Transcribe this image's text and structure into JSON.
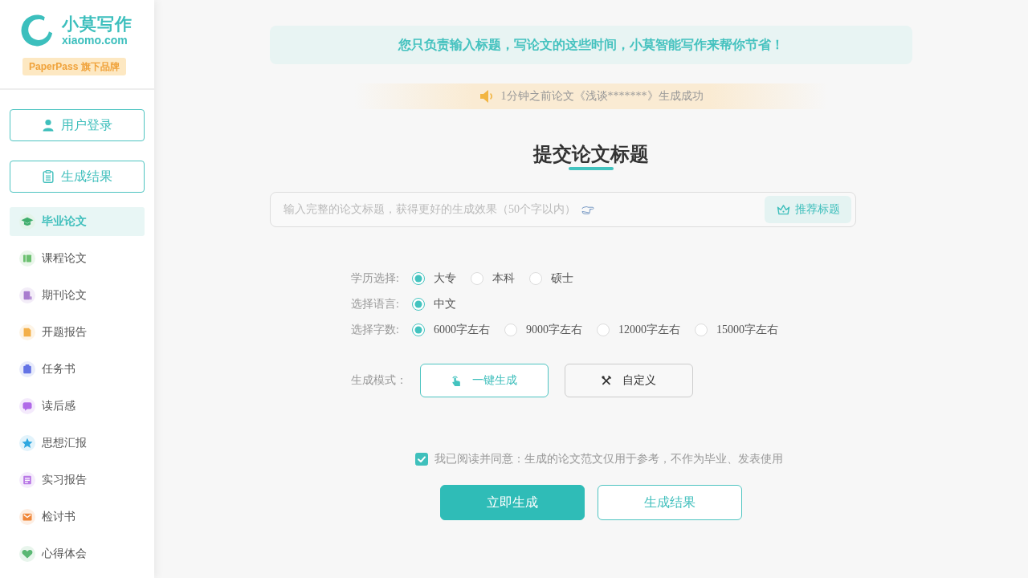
{
  "sidebar": {
    "logo": {
      "name": "小莫写作",
      "domain": "xiaomo.com",
      "badge": "PaperPass 旗下品牌"
    },
    "buttons": [
      {
        "label": "用户登录"
      },
      {
        "label": "生成结果"
      }
    ],
    "items": [
      {
        "label": "毕业论文",
        "selected": true,
        "color": "#3fae6c"
      },
      {
        "label": "课程论文",
        "selected": false,
        "color": "#6cc070"
      },
      {
        "label": "期刊论文",
        "selected": false,
        "color": "#a97ccf"
      },
      {
        "label": "开题报告",
        "selected": false,
        "color": "#f3b04a"
      },
      {
        "label": "任务书",
        "selected": false,
        "color": "#6474e5"
      },
      {
        "label": "读后感",
        "selected": false,
        "color": "#b06ae8"
      },
      {
        "label": "思想汇报",
        "selected": false,
        "color": "#2ea7e0"
      },
      {
        "label": "实习报告",
        "selected": false,
        "color": "#b979e6"
      },
      {
        "label": "检讨书",
        "selected": false,
        "color": "#f0873a"
      },
      {
        "label": "心得体会",
        "selected": false,
        "color": "#5bb874"
      }
    ]
  },
  "banner": "您只负责输入标题，写论文的这些时间，小莫智能写作来帮你节省！",
  "notice": "1分钟之前论文《浅谈*******》生成成功",
  "form": {
    "title": "提交论文标题",
    "title_input": {
      "placeholder": "输入完整的论文标题，获得更好的生成效果（50个字以内）",
      "button": "推荐标题"
    },
    "option_groups": [
      {
        "label": "学历选择:",
        "options": [
          {
            "label": "大专",
            "selected": true
          },
          {
            "label": "本科",
            "selected": false
          },
          {
            "label": "硕士",
            "selected": false
          }
        ]
      },
      {
        "label": "选择语言:",
        "options": [
          {
            "label": "中文",
            "selected": true
          }
        ]
      },
      {
        "label": "选择字数:",
        "options": [
          {
            "label": "6000字左右",
            "selected": true
          },
          {
            "label": "9000字左右",
            "selected": false
          },
          {
            "label": "12000字左右",
            "selected": false
          },
          {
            "label": "15000字左右",
            "selected": false
          }
        ]
      }
    ],
    "mode": {
      "label": "生成模式：",
      "options": [
        {
          "label": "一键生成",
          "selected": true
        },
        {
          "label": "自定义",
          "selected": false
        }
      ]
    },
    "agreement": {
      "checked": true,
      "text": "我已阅读并同意：生成的论文范文仅用于参考，不作为毕业、发表使用"
    },
    "actions": [
      {
        "label": "立即生成",
        "kind": "primary"
      },
      {
        "label": "生成结果",
        "kind": "outline"
      }
    ]
  }
}
